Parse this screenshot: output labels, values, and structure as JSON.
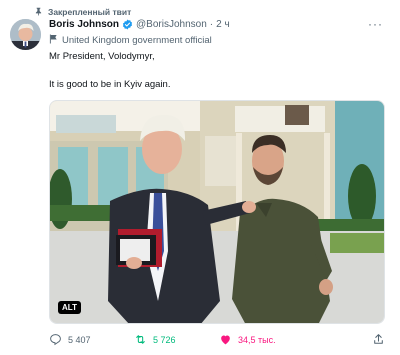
{
  "pinned": {
    "label": "Закрепленный твит"
  },
  "author": {
    "name": "Boris Johnson",
    "handle": "@BorisJohnson",
    "time": "2 ч",
    "label": "United Kingdom government official"
  },
  "tweet": {
    "line1": "Mr President, Volodymyr,",
    "line2": "It is good to be in Kyiv again.",
    "alt_badge": "ALT"
  },
  "stats": {
    "replies": "5 407",
    "retweets": "5 726",
    "likes": "34,5 тыс."
  },
  "colors": {
    "verified": "#1d9bf0",
    "retweet_active": "#00ba7c",
    "like_active": "#f91880",
    "muted": "#536471"
  },
  "icons": {
    "pin": "pin-icon",
    "verified": "verified-badge-icon",
    "more": "more-icon",
    "label": "flag-icon",
    "reply": "reply-icon",
    "retweet": "retweet-icon",
    "like": "heart-icon",
    "share": "share-icon"
  }
}
